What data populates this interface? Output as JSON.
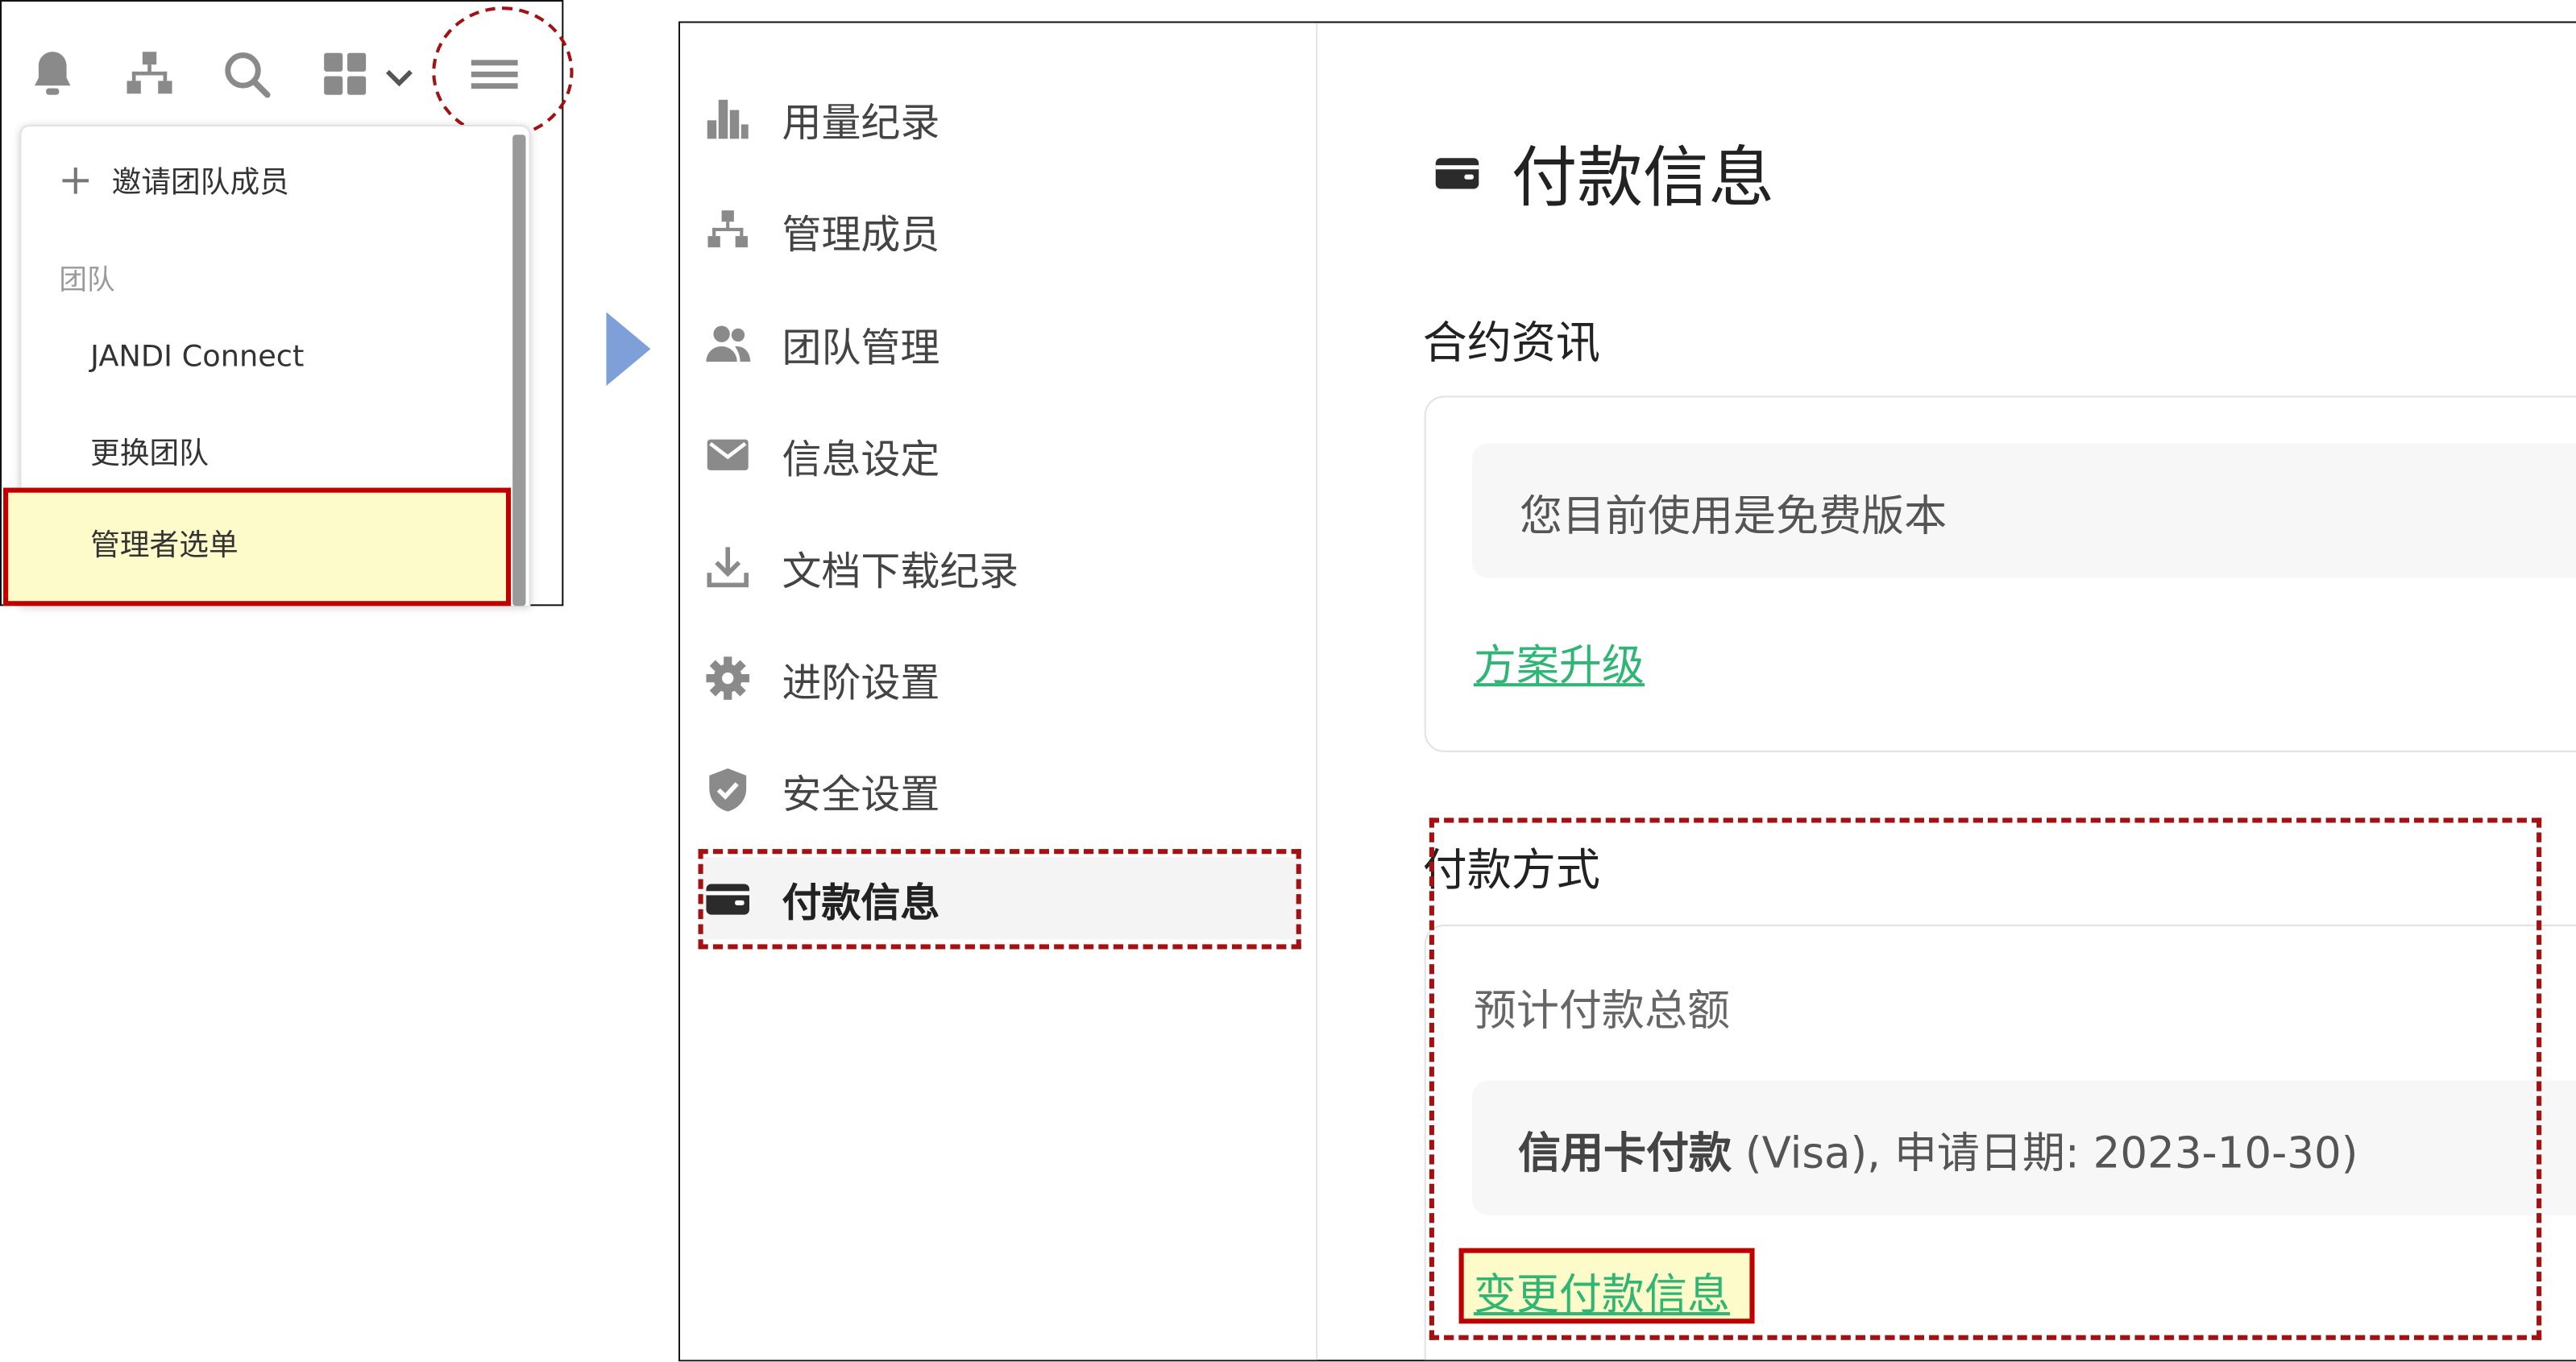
{
  "dropdown": {
    "invite_label": "邀请团队成员",
    "team_header": "团队",
    "items": [
      "JANDI Connect",
      "更换团队"
    ],
    "admin_menu": "管理者选单"
  },
  "icons": {
    "toolbar": [
      "bell-icon",
      "org-chart-icon",
      "search-icon",
      "apps-grid-icon",
      "chevron-down-icon",
      "hamburger-menu-icon"
    ],
    "arrow": "play-triangle-icon"
  },
  "sidebar": {
    "items": [
      {
        "label": "用量纪录",
        "icon": "bar-chart-icon"
      },
      {
        "label": "管理成员",
        "icon": "org-chart-icon"
      },
      {
        "label": "团队管理",
        "icon": "users-icon"
      },
      {
        "label": "信息设定",
        "icon": "envelope-icon"
      },
      {
        "label": "文档下载纪录",
        "icon": "download-icon"
      },
      {
        "label": "进阶设置",
        "icon": "gear-icon"
      },
      {
        "label": "安全设置",
        "icon": "shield-icon"
      },
      {
        "label": "付款信息",
        "icon": "wallet-icon",
        "active": true
      }
    ]
  },
  "main": {
    "title": "付款信息",
    "contract": {
      "title": "合约资讯",
      "status_text": "您目前使用是免费版本",
      "upgrade_link": "方案升级"
    },
    "payment": {
      "title": "付款方式",
      "estimate_label": "预计付款总额",
      "method_bold": "信用卡付款",
      "method_detail": " (Visa), 申请日期: 2023-10-30)",
      "change_link": "变更付款信息"
    }
  },
  "colors": {
    "highlight_border": "#c00000",
    "highlight_fill": "#fdfbc9",
    "link": "#2fb574",
    "arrow": "#7f9fd9",
    "icon_gray": "#8a8a8a"
  }
}
